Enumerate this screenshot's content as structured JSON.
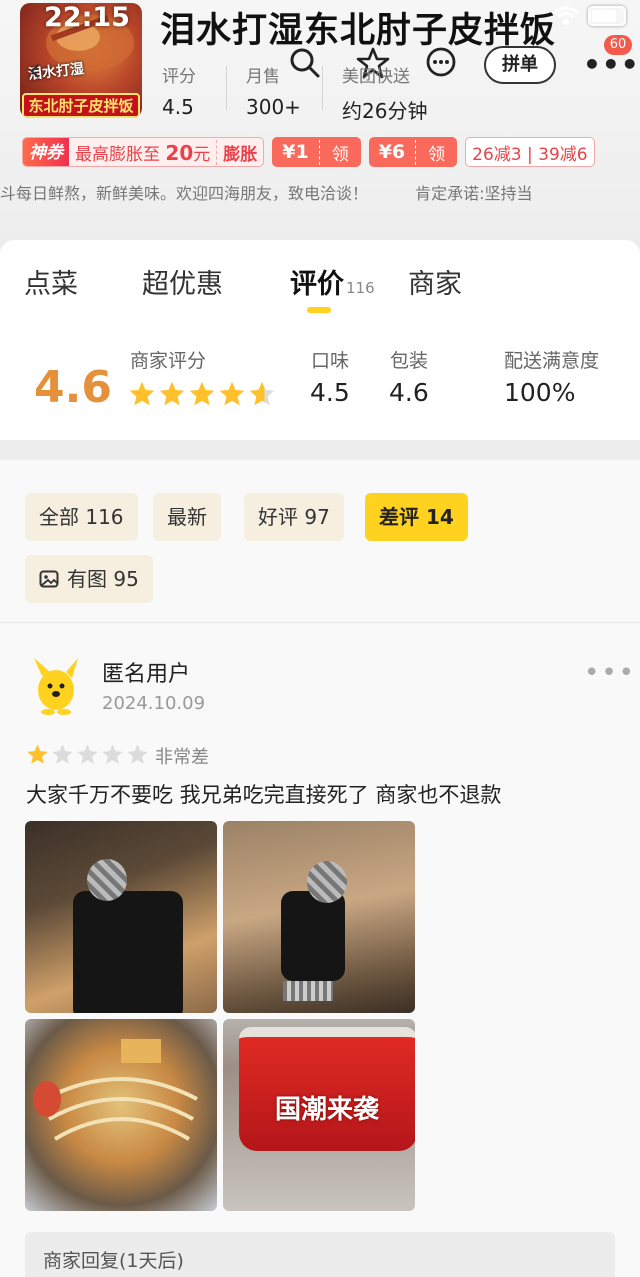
{
  "status_bar": {
    "time": "22:15"
  },
  "store": {
    "name": "泪水打湿东北肘子皮拌饭",
    "logo_line1": "泪水打湿",
    "logo_line2": "东北肘子皮拌饭"
  },
  "header": {
    "pin_label": "拼单",
    "cart_badge": "60",
    "stats": [
      {
        "label": "评分",
        "value": "4.5"
      },
      {
        "label": "月售",
        "value": "300+"
      },
      {
        "label": "美团快送",
        "value": "约26分钟"
      }
    ]
  },
  "coupons": {
    "god_tag": "神券",
    "god_prefix": "最高膨胀至",
    "god_amount": "20",
    "god_unit": "元",
    "god_action": "膨胀",
    "yen1_amount": "¥1",
    "yen1_action": "领",
    "yen2_amount": "¥6",
    "yen2_action": "领",
    "discount": "26减3 | 39减6"
  },
  "notice": {
    "left": "斗每日鲜熬，新鲜美味。欢迎四海朋友，致电洽谈！",
    "right": "肯定承诺:坚持当"
  },
  "tabs": [
    {
      "label": "点菜"
    },
    {
      "label": "超优惠"
    },
    {
      "label": "评价",
      "count": "116"
    },
    {
      "label": "商家"
    }
  ],
  "score": {
    "overall": "4.6",
    "overall_label": "商家评分",
    "overall_stars": 4.6,
    "taste_label": "口味",
    "taste": "4.5",
    "package_label": "包装",
    "package": "4.6",
    "delivery_label": "配送满意度",
    "delivery": "100%"
  },
  "filters": {
    "all": "全部 116",
    "latest": "最新",
    "good": "好评 97",
    "bad": "差评 14",
    "with_pics": "有图 95"
  },
  "review": {
    "user": "匿名用户",
    "date": "2024.10.09",
    "stars": 1,
    "rating_text": "非常差",
    "text": "大家千万不要吃 我兄弟吃完直接死了 商家也不退款",
    "bowl_label": "国潮来袭",
    "reply_label": "商家回复(1天后)"
  },
  "colors": {
    "accent": "#ffd21f",
    "score": "#e5903a",
    "coupon_red": "#f96a5d",
    "star": "#ffc12b"
  },
  "icons": [
    "back-icon",
    "search-icon",
    "star-outline-icon",
    "chat-icon",
    "more-icon",
    "wifi-icon",
    "battery-icon",
    "image-icon",
    "dots-icon",
    "star-icon"
  ]
}
